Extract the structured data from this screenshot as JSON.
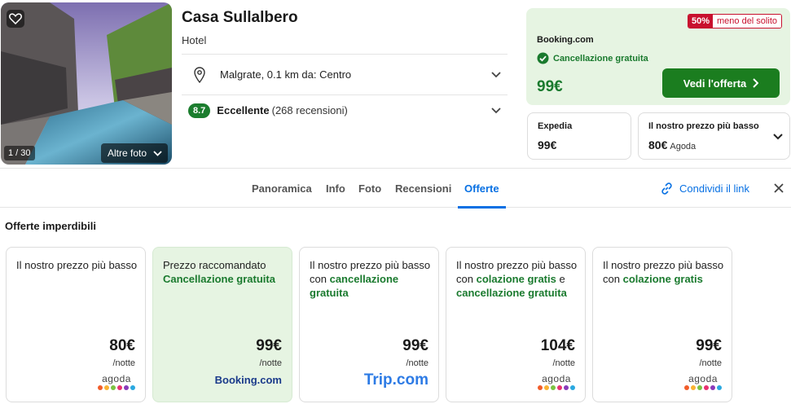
{
  "photo": {
    "counter": "1 / 30",
    "more_label": "Altre foto"
  },
  "hotel": {
    "name": "Casa Sullalbero",
    "type": "Hotel",
    "location": "Malgrate, 0.1 km da: Centro",
    "score": "8.7",
    "rating_word": "Eccellente",
    "rating_count": "(268 recensioni)"
  },
  "best_offer": {
    "badge_pct": "50%",
    "badge_text": "meno del solito",
    "provider": "Booking.com",
    "cancellation": "Cancellazione gratuita",
    "price": "99€",
    "cta": "Vedi l'offerta"
  },
  "alt_offers": [
    {
      "title": "Expedia",
      "price": "99€",
      "provider": ""
    },
    {
      "title": "Il nostro prezzo più basso",
      "price": "80€",
      "provider": "Agoda"
    }
  ],
  "tabs": [
    {
      "label": "Panoramica"
    },
    {
      "label": "Info"
    },
    {
      "label": "Foto"
    },
    {
      "label": "Recensioni"
    },
    {
      "label": "Offerte"
    }
  ],
  "active_tab": "Offerte",
  "share_label": "Condividi il link",
  "section_title": "Offerte imperdibili",
  "offers": [
    {
      "pre": "Il nostro prezzo più basso",
      "bold1": "",
      "mid": "",
      "bold2": "",
      "price": "80€",
      "per": "/notte",
      "logo": "agoda"
    },
    {
      "pre": "Prezzo raccomandato",
      "bold1": "Cancellazione gratuita",
      "mid": "",
      "bold2": "",
      "price": "99€",
      "per": "/notte",
      "logo": "Booking.com"
    },
    {
      "pre": "Il nostro prezzo più basso con",
      "bold1": "cancellazione gratuita",
      "mid": "",
      "bold2": "",
      "price": "99€",
      "per": "/notte",
      "logo": "Trip.com"
    },
    {
      "pre": "Il nostro prezzo più basso con",
      "bold1": "colazione gratis",
      "mid": "e",
      "bold2": "cancellazione gratuita",
      "price": "104€",
      "per": "/notte",
      "logo": "agoda"
    },
    {
      "pre": "Il nostro prezzo più basso con",
      "bold1": "colazione gratis",
      "mid": "",
      "bold2": "",
      "price": "99€",
      "per": "/notte",
      "logo": "agoda"
    }
  ],
  "colors": {
    "accent_blue": "#0770e3",
    "green": "#1a7a2e",
    "cta_green": "#1b7d1f",
    "badge_red": "#c8102e",
    "reco_bg": "#e6f4e2"
  },
  "agoda_dot_colors": [
    "#f25d2a",
    "#f9b233",
    "#7cc242",
    "#e9316f",
    "#8a3ab9",
    "#2aa8e0"
  ]
}
